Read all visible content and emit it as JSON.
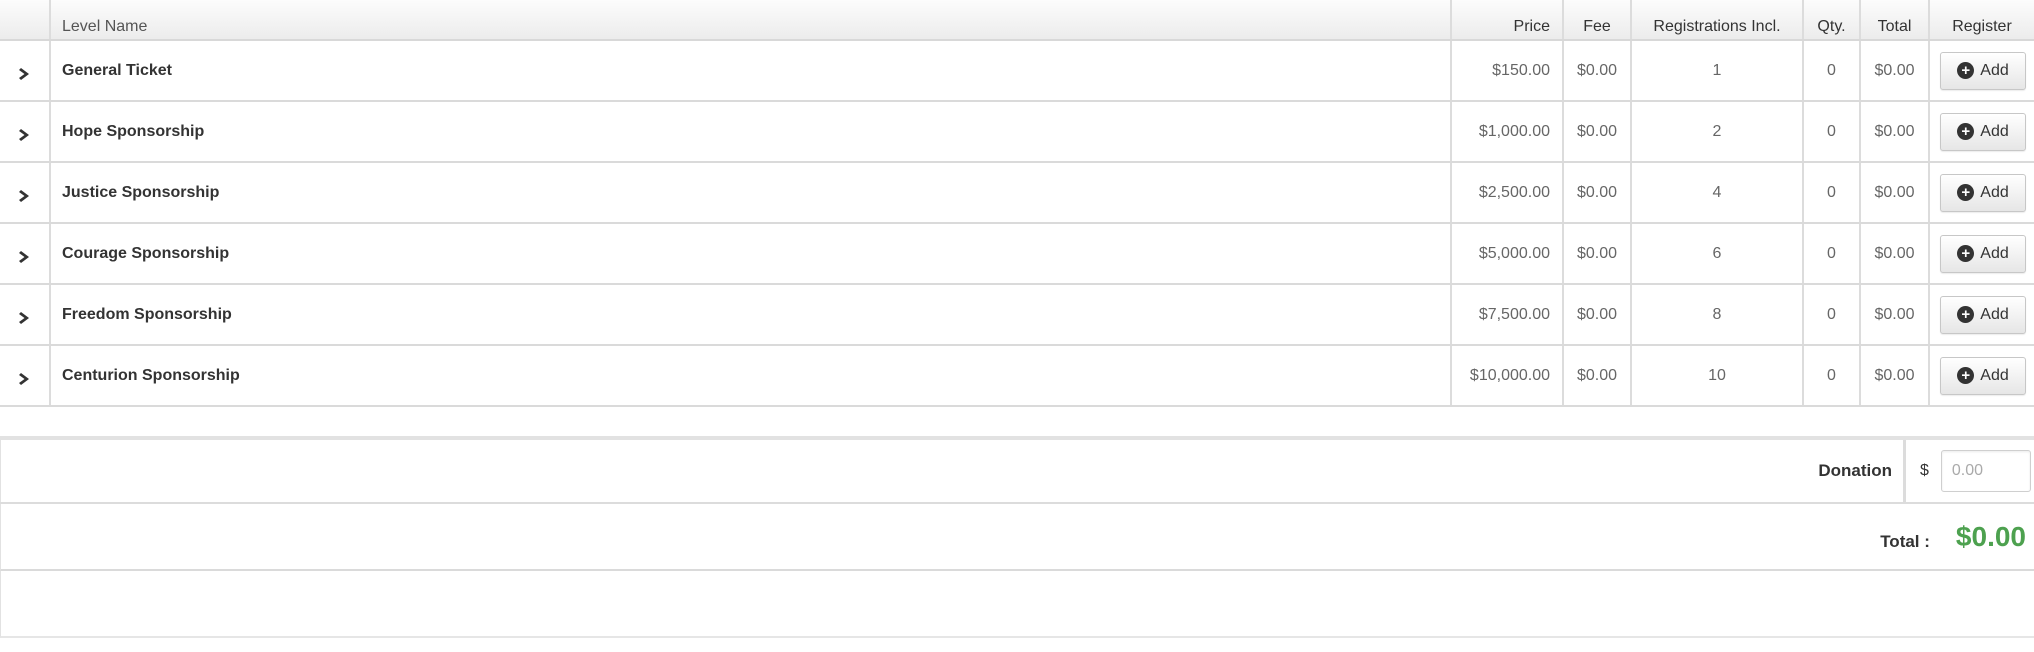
{
  "columns": {
    "level_name": "Level Name",
    "price": "Price",
    "fee": "Fee",
    "registrations": "Registrations Incl.",
    "qty": "Qty.",
    "total": "Total",
    "register": "Register"
  },
  "rows": [
    {
      "name": "General Ticket",
      "price": "$150.00",
      "fee": "$0.00",
      "registrations": "1",
      "qty": "0",
      "total": "$0.00",
      "button": "Add"
    },
    {
      "name": "Hope Sponsorship",
      "price": "$1,000.00",
      "fee": "$0.00",
      "registrations": "2",
      "qty": "0",
      "total": "$0.00",
      "button": "Add"
    },
    {
      "name": "Justice Sponsorship",
      "price": "$2,500.00",
      "fee": "$0.00",
      "registrations": "4",
      "qty": "0",
      "total": "$0.00",
      "button": "Add"
    },
    {
      "name": "Courage Sponsorship",
      "price": "$5,000.00",
      "fee": "$0.00",
      "registrations": "6",
      "qty": "0",
      "total": "$0.00",
      "button": "Add"
    },
    {
      "name": "Freedom Sponsorship",
      "price": "$7,500.00",
      "fee": "$0.00",
      "registrations": "8",
      "qty": "0",
      "total": "$0.00",
      "button": "Add"
    },
    {
      "name": "Centurion Sponsorship",
      "price": "$10,000.00",
      "fee": "$0.00",
      "registrations": "10",
      "qty": "0",
      "total": "$0.00",
      "button": "Add"
    }
  ],
  "donation": {
    "label": "Donation",
    "currency": "$",
    "placeholder": "0.00"
  },
  "summary": {
    "total_label": "Total :",
    "total_value": "$0.00"
  },
  "icons": {
    "expand": "chevron-right-icon",
    "add": "plus-circle-icon"
  },
  "colors": {
    "total_value": "#4da14f"
  }
}
